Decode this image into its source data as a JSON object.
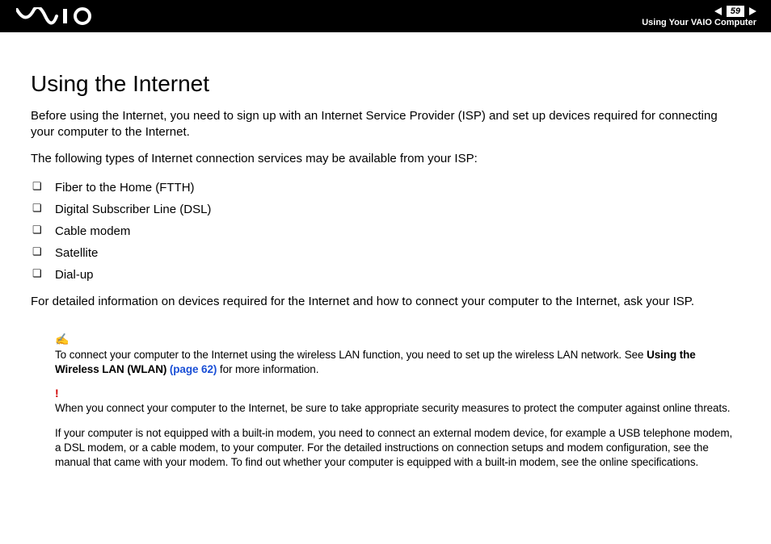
{
  "header": {
    "page_number": "59",
    "section": "Using Your VAIO Computer"
  },
  "title": "Using the Internet",
  "intro1": "Before using the Internet, you need to sign up with an Internet Service Provider (ISP) and set up devices required for connecting your computer to the Internet.",
  "intro2": "The following types of Internet connection services may be available from your ISP:",
  "bullets": [
    "Fiber to the Home (FTTH)",
    "Digital Subscriber Line (DSL)",
    "Cable modem",
    "Satellite",
    "Dial-up"
  ],
  "para3": "For detailed information on devices required for the Internet and how to connect your computer to the Internet, ask your ISP.",
  "note1_icon": "✍",
  "note1_pre": "To connect your computer to the Internet using the wireless LAN function, you need to set up the wireless LAN network. See ",
  "note1_bold": "Using the Wireless LAN (WLAN) ",
  "note1_link": "(page 62)",
  "note1_post": " for more information.",
  "note2_icon": "!",
  "note2": "When you connect your computer to the Internet, be sure to take appropriate security measures to protect the computer against online threats.",
  "note3": "If your computer is not equipped with a built-in modem, you need to connect an external modem device, for example a USB telephone modem, a DSL modem, or a cable modem, to your computer. For the detailed instructions on connection setups and modem configuration, see the manual that came with your modem. To find out whether your computer is equipped with a built-in modem, see the online specifications."
}
